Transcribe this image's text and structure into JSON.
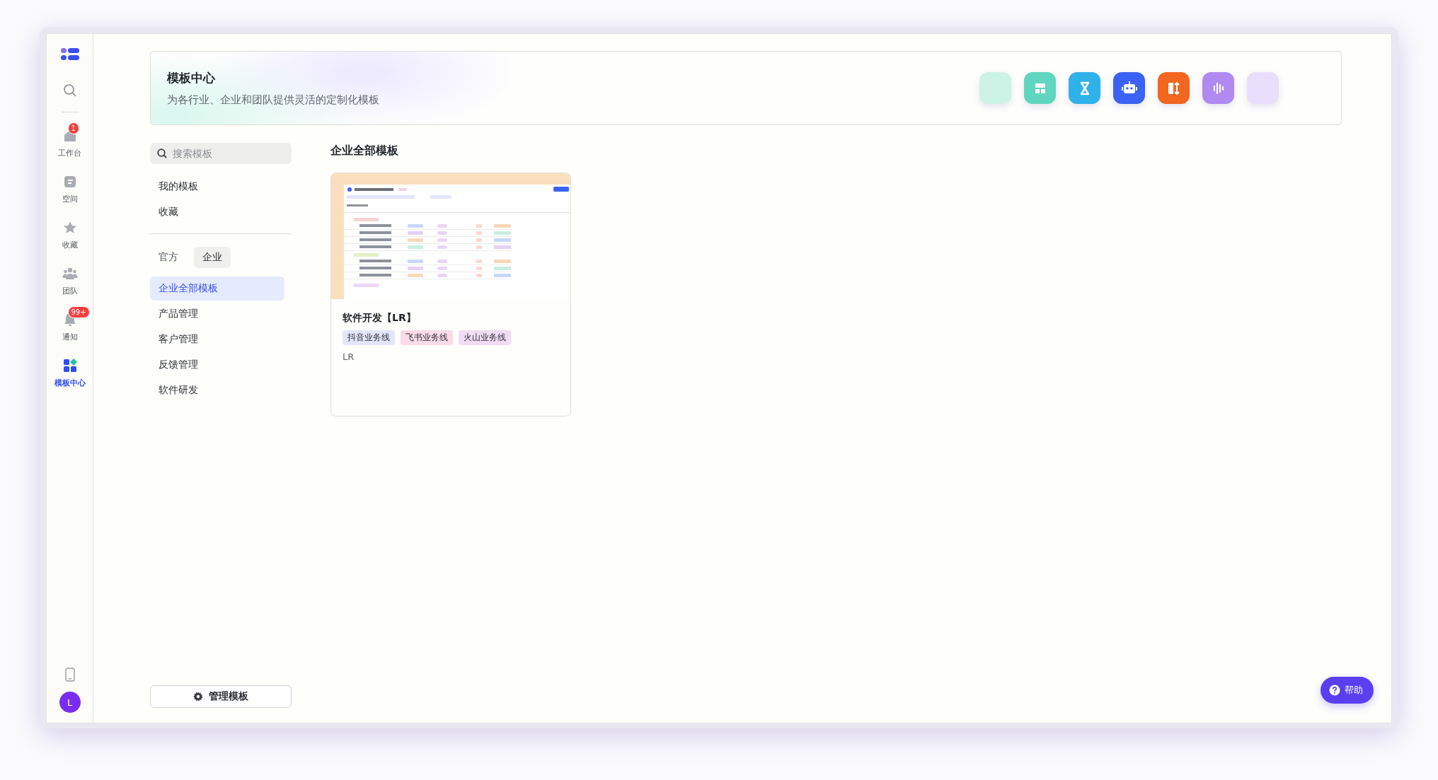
{
  "sidebar": {
    "items": [
      {
        "kind": "home",
        "label": "工作台",
        "badge": "1",
        "selected": false
      },
      {
        "kind": "space",
        "label": "空间",
        "selected": false
      },
      {
        "kind": "star",
        "label": "收藏",
        "selected": false
      },
      {
        "kind": "team",
        "label": "团队",
        "selected": false
      },
      {
        "kind": "bell",
        "label": "通知",
        "badge": "99+",
        "selected": false
      },
      {
        "kind": "grid",
        "label": "模板中心",
        "selected": true
      }
    ],
    "avatar": "L"
  },
  "header": {
    "title": "模板中心",
    "subtitle": "为各行业、企业和团队提供灵活的定制化模板",
    "apps": [
      {
        "kind": "blank",
        "color": "#cdf3e6"
      },
      {
        "kind": "layout",
        "color": "#5fd6bd"
      },
      {
        "kind": "hourglass",
        "color": "#2fb1ea"
      },
      {
        "kind": "robot",
        "color": "#3a63f5"
      },
      {
        "kind": "swap",
        "color": "#f2661f"
      },
      {
        "kind": "voice",
        "color": "#b08af0"
      },
      {
        "kind": "blank",
        "color": "#e9defb"
      }
    ]
  },
  "nav": {
    "search": {
      "placeholder": "搜索模板"
    },
    "links": [
      "我的模板",
      "收藏"
    ],
    "tabs": [
      {
        "label": "官方",
        "selected": false
      },
      {
        "label": "企业",
        "selected": true
      }
    ],
    "categories": [
      {
        "label": "企业全部模板",
        "selected": true
      },
      {
        "label": "产品管理",
        "selected": false
      },
      {
        "label": "客户管理",
        "selected": false
      },
      {
        "label": "反馈管理",
        "selected": false
      },
      {
        "label": "软件研发",
        "selected": false
      }
    ],
    "manage_button": "管理模板"
  },
  "content": {
    "title": "企业全部模板",
    "cards": [
      {
        "title": "软件开发【LR】",
        "tags": [
          {
            "label": "抖音业务线",
            "color": "#e3e5fa"
          },
          {
            "label": "飞书业务线",
            "color": "#fadbe7"
          },
          {
            "label": "火山业务线",
            "color": "#f1dcf4"
          }
        ],
        "owner": "LR"
      }
    ]
  },
  "help_button": "帮助"
}
